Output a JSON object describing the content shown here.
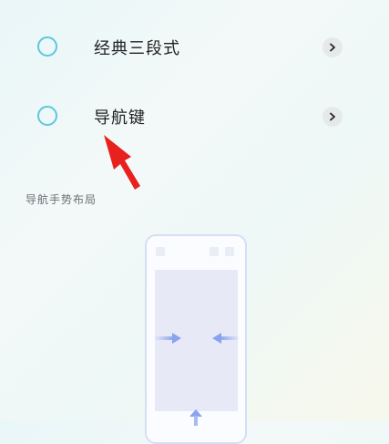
{
  "options": [
    {
      "label": "经典三段式",
      "selected": false
    },
    {
      "label": "导航键",
      "selected": false
    }
  ],
  "section": {
    "title": "导航手势布局"
  },
  "colors": {
    "radio": "#5cc8de",
    "annotation_arrow": "#e8201e",
    "gesture_arrow": "#8aa3ee"
  },
  "icons": {
    "chevron": "chevron-right-icon",
    "annotation": "red-arrow-pointer"
  }
}
